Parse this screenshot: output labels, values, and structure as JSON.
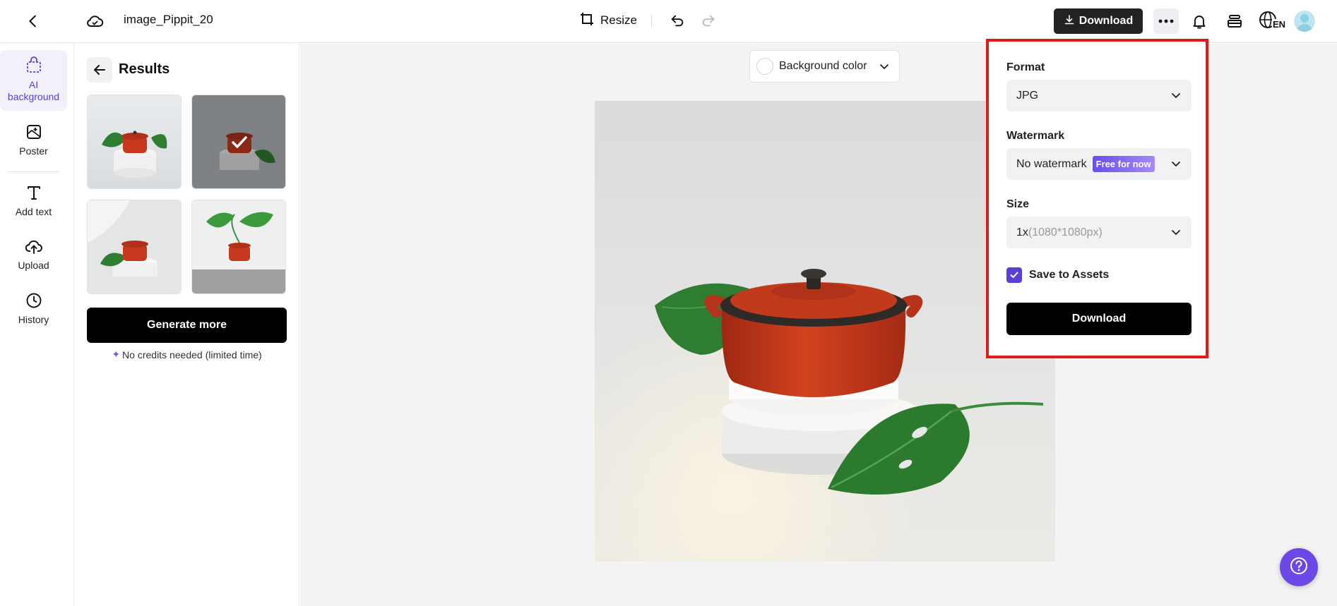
{
  "header": {
    "doc_title": "image_Pippit_20",
    "resize_label": "Resize",
    "download_label": "Download",
    "language": "EN"
  },
  "rail": {
    "items": [
      {
        "label": "AI background",
        "icon": "bag-icon"
      },
      {
        "label": "Poster",
        "icon": "poster-icon"
      },
      {
        "label": "Add text",
        "icon": "text-icon"
      },
      {
        "label": "Upload",
        "icon": "upload-cloud-icon"
      },
      {
        "label": "History",
        "icon": "clock-icon"
      }
    ]
  },
  "results": {
    "title": "Results",
    "generate_label": "Generate more",
    "credits_note": "No credits needed (limited time)",
    "selected_index": 1
  },
  "canvas": {
    "bg_color_label": "Background color"
  },
  "download_panel": {
    "format_label": "Format",
    "format_value": "JPG",
    "watermark_label": "Watermark",
    "watermark_value": "No watermark",
    "watermark_badge": "Free for now",
    "size_label": "Size",
    "size_value": "1x",
    "size_detail": "(1080*1080px)",
    "save_assets_label": "Save to Assets",
    "save_assets_checked": true,
    "download_label": "Download"
  },
  "colors": {
    "accent": "#5b3fd6",
    "highlight_border": "#e11a1a",
    "pot": "#c8381e",
    "leaf": "#2f7d32"
  }
}
